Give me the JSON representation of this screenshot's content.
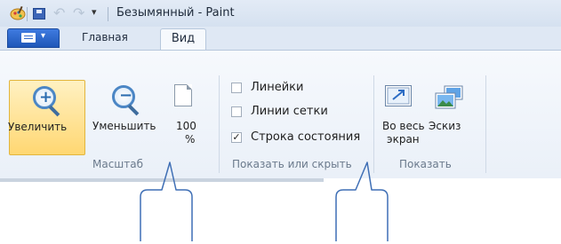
{
  "window": {
    "title": "Безымянный - Paint"
  },
  "quick_access": {
    "icons": [
      "paint-app-icon",
      "save-icon",
      "undo-icon",
      "redo-icon",
      "customize-dropdown-icon"
    ],
    "undo_glyph": "↶",
    "redo_glyph": "↷",
    "dropdown_glyph": "▾"
  },
  "tabs": [
    {
      "label": "Главная",
      "active": false
    },
    {
      "label": "Вид",
      "active": true
    }
  ],
  "app_menu": {
    "caret": "▾"
  },
  "groups": {
    "zoom": {
      "label": "Масштаб",
      "zoom_in": "Увеличить",
      "zoom_out": "Уменьшить",
      "zoom_100_line1": "100",
      "zoom_100_line2": "%"
    },
    "show_hide": {
      "label": "Показать или скрыть",
      "items": [
        {
          "label": "Линейки",
          "checked": false
        },
        {
          "label": "Линии сетки",
          "checked": false
        },
        {
          "label": "Строка состояния",
          "checked": true
        }
      ],
      "check_glyph": "✓"
    },
    "display": {
      "label": "Показать",
      "fullscreen_line1": "Во весь",
      "fullscreen_line2": "экран",
      "thumbnail": "Эскиз"
    }
  },
  "colors": {
    "accent": "#2b5fbf",
    "active_button": "#ffd772",
    "callout_stroke": "#3f6fb5"
  }
}
